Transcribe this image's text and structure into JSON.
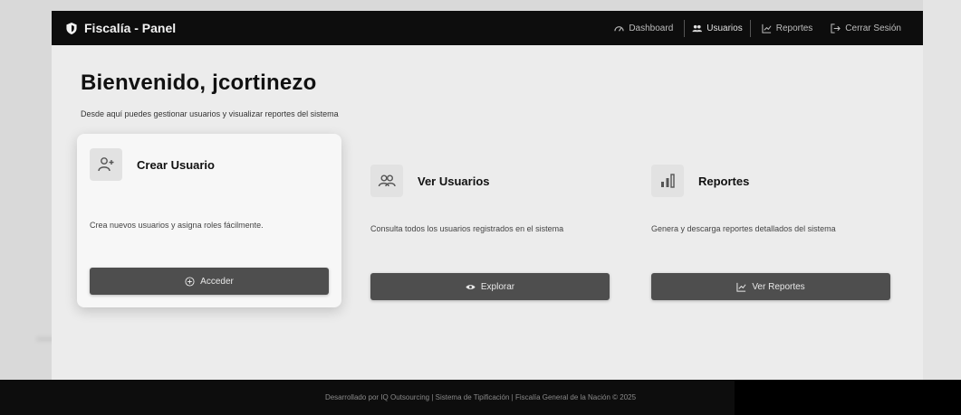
{
  "navbar": {
    "brand": "Fiscalía - Panel",
    "links": [
      {
        "label": "Dashboard",
        "icon": "dashboard-icon"
      },
      {
        "label": "Usuarios",
        "icon": "users-icon"
      },
      {
        "label": "Reportes",
        "icon": "chart-line-icon"
      },
      {
        "label": "Cerrar Sesión",
        "icon": "logout-icon"
      }
    ]
  },
  "main": {
    "welcome": "Bienvenido, jcortinezo",
    "subtitle": "Desde aquí puedes gestionar usuarios y visualizar reportes del sistema"
  },
  "cards": [
    {
      "title": "Crear Usuario",
      "description": "Crea nuevos usuarios y asigna roles fácilmente.",
      "button": "Acceder",
      "icon": "user-plus-icon",
      "button_icon": "plus-circle-icon"
    },
    {
      "title": "Ver Usuarios",
      "description": "Consulta todos los usuarios registrados en el sistema",
      "button": "Explorar",
      "icon": "users-group-icon",
      "button_icon": "eye-icon"
    },
    {
      "title": "Reportes",
      "description": "Genera y descarga reportes detallados del sistema",
      "button": "Ver Reportes",
      "icon": "bar-chart-icon",
      "button_icon": "chart-line-icon"
    }
  ],
  "footer": {
    "text": "Desarrollado por IQ Outsourcing | Sistema de Tipificación | Fiscalía General de la Nación © 2025"
  },
  "colors": {
    "navbar_bg": "#0d0d0d",
    "button_bg": "#4e4e4e",
    "page_bg": "#ececec"
  }
}
